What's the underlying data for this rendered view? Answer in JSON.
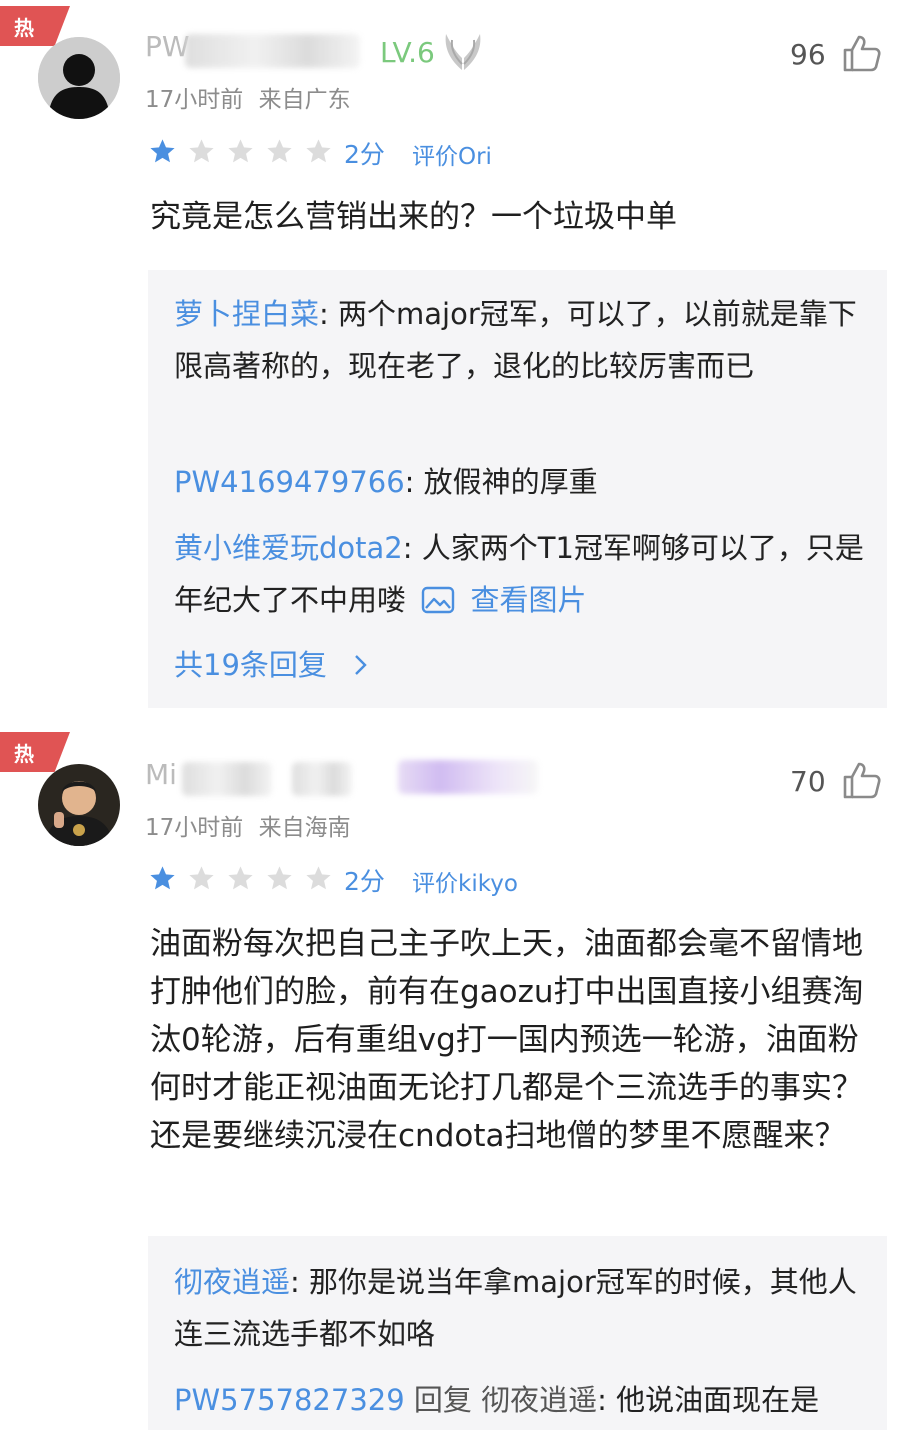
{
  "comments": [
    {
      "badge": "热",
      "username_visible": "PW",
      "level": "LV.6",
      "time": "17小时前",
      "location": "来自广东",
      "likes": "96",
      "rating_stars": 1,
      "rating_max": 5,
      "score": "2分",
      "rating_target": "评价Ori",
      "text": "究竟是怎么营销出来的？一个垃圾中单",
      "replies": [
        {
          "author": "萝卜捏白菜",
          "sep": ":",
          "text": "两个major冠军，可以了，以前就是靠下限高著称的，现在老了，退化的比较厉害而已"
        },
        {
          "author": "PW4169479766",
          "sep": ":",
          "text": "放假神的厚重"
        },
        {
          "author": "黄小维爱玩dota2",
          "sep": ":",
          "text": "人家两个T1冠军啊够可以了，只是年纪大了不中用喽",
          "image_link": "查看图片"
        }
      ],
      "more_replies": "共19条回复"
    },
    {
      "badge": "热",
      "username_visible": "Mi",
      "time": "17小时前",
      "location": "来自海南",
      "likes": "70",
      "rating_stars": 1,
      "rating_max": 5,
      "score": "2分",
      "rating_target": "评价kikyo",
      "text": "油面粉每次把自己主子吹上天，油面都会毫不留情地打肿他们的脸，前有在gaozu打中出国直接小组赛淘汰0轮游，后有重组vg打一国内预选一轮游，油面粉何时才能正视油面无论打几都是个三流选手的事实？还是要继续沉浸在cndota扫地僧的梦里不愿醒来？",
      "replies": [
        {
          "author": "彻夜逍遥",
          "sep": ":",
          "text": "那你是说当年拿major冠军的时候，其他人连三流选手都不如咯"
        },
        {
          "author": "PW5757827329",
          "reply_word": "回复",
          "reply_to": "彻夜逍遥",
          "sep": ":",
          "text": "他说油面现在是"
        }
      ]
    }
  ],
  "colors": {
    "accent": "#4a8fe0",
    "hot": "#e05454",
    "level": "#7bc97d",
    "star_on": "#4a8fe0",
    "star_off": "#dcdcdc"
  },
  "icons": [
    "thumbs-up-icon",
    "star-icon",
    "image-icon",
    "chevron-right-icon",
    "wings-icon"
  ]
}
